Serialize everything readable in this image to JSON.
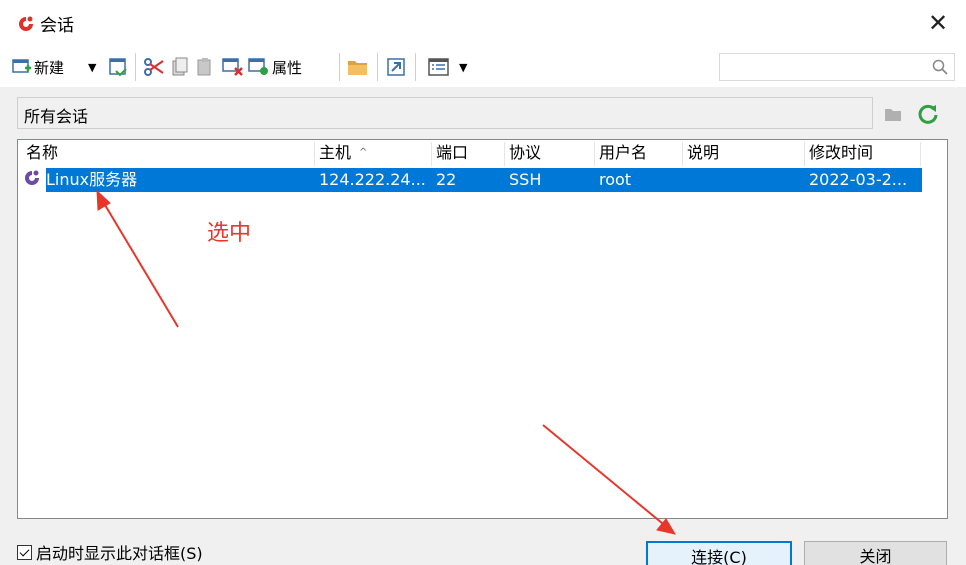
{
  "window": {
    "title": "会话",
    "close_glyph": "✕",
    "icon": "app-logo-icon"
  },
  "toolbar": {
    "new_label": "新建",
    "properties_label": "属性",
    "search_placeholder": "",
    "icons": [
      "new-session-icon",
      "dropdown-arrow-icon",
      "save-icon",
      "cut-icon",
      "copy-icon",
      "paste-icon",
      "delete-icon",
      "properties-icon",
      "folder-icon",
      "shortcut-icon",
      "view-icon",
      "dropdown-arrow-icon",
      "search-icon"
    ]
  },
  "path_bar": {
    "label": "所有会话",
    "icons": [
      "new-folder-icon",
      "refresh-icon"
    ]
  },
  "table": {
    "columns": [
      "名称",
      "主机",
      "端口",
      "协议",
      "用户名",
      "说明",
      "修改时间"
    ],
    "sorted_column": "主机",
    "sort_glyph": "^",
    "rows": [
      {
        "name": "Linux服务器",
        "host": "124.222.24...",
        "port": "22",
        "protocol": "SSH",
        "user": "root",
        "note": "",
        "modified": "2022-03-2...",
        "selected": true
      }
    ]
  },
  "footer": {
    "show_on_startup_label": "启动时显示此对话框(S)",
    "show_on_startup_checked": true,
    "connect_label": "连接(C)",
    "close_label": "关闭"
  },
  "annotation": {
    "text": "选中",
    "color": "#e8362b"
  },
  "colors": {
    "selection": "#0078d7",
    "window_bg": "#f0f0f0",
    "refresh_green": "#2ea043"
  }
}
